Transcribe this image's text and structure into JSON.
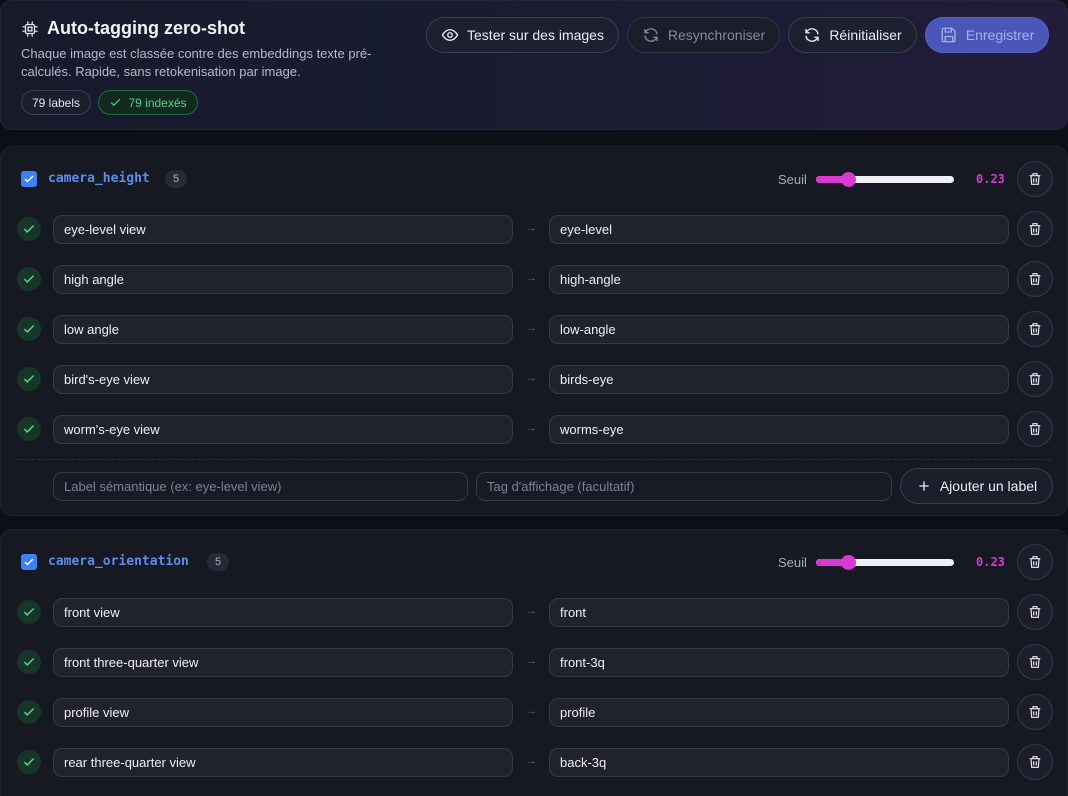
{
  "header": {
    "title": "Auto-tagging zero-shot",
    "description": "Chaque image est classée contre des embeddings texte pré-calculés. Rapide, sans retokenisation par image.",
    "labels_badge": "79 labels",
    "indexed_badge": "79 indexés",
    "buttons": {
      "test": "Tester sur des images",
      "resync": "Resynchroniser",
      "reset": "Réinitialiser",
      "save": "Enregistrer"
    }
  },
  "threshold_label": "Seuil",
  "groups": [
    {
      "name": "camera_height",
      "count": "5",
      "enabled": true,
      "threshold": 0.23,
      "threshold_text": "0.23",
      "rows": [
        {
          "label": "eye-level view",
          "tag": "eye-level"
        },
        {
          "label": "high angle",
          "tag": "high-angle"
        },
        {
          "label": "low angle",
          "tag": "low-angle"
        },
        {
          "label": "bird's-eye view",
          "tag": "birds-eye"
        },
        {
          "label": "worm's-eye view",
          "tag": "worms-eye"
        }
      ],
      "add": {
        "semantic_placeholder": "Label sémantique (ex: eye-level view)",
        "display_placeholder": "Tag d'affichage (facultatif)",
        "button": "Ajouter un label"
      }
    },
    {
      "name": "camera_orientation",
      "count": "5",
      "enabled": true,
      "threshold": 0.23,
      "threshold_text": "0.23",
      "rows": [
        {
          "label": "front view",
          "tag": "front"
        },
        {
          "label": "front three-quarter view",
          "tag": "front-3q"
        },
        {
          "label": "profile view",
          "tag": "profile"
        },
        {
          "label": "rear three-quarter view",
          "tag": "back-3q"
        }
      ]
    }
  ],
  "colors": {
    "accent": "#d63ad1",
    "primary": "#4a56b8",
    "success": "#4fd68b",
    "group_name": "#5b8def"
  },
  "icons": {
    "title": "cpu-chip-icon",
    "test": "eye-icon",
    "resync": "refresh-icon",
    "reset": "rotate-icon",
    "save": "save-icon",
    "delete": "trash-icon",
    "row_status": "check-icon",
    "add": "plus-icon"
  }
}
